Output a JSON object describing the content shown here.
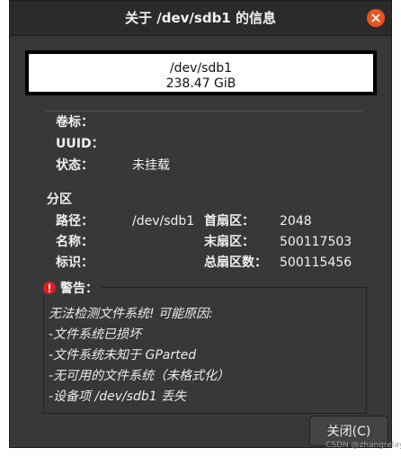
{
  "window": {
    "title": "关于 /dev/sdb1 的信息",
    "close_icon": "close-icon",
    "accent": "#e95420"
  },
  "device_box": {
    "path": "/dev/sdb1",
    "size": "238.47 GiB"
  },
  "filesystem": {
    "label_label": "卷标：",
    "uuid_label": "UUID：",
    "status_label": "状态：",
    "status_value": "未挂载"
  },
  "partition": {
    "heading": "分区",
    "path_label": "路径：",
    "path_value": "/dev/sdb1",
    "name_label": "名称：",
    "flags_label": "标识：",
    "first_sector_label": "首扇区：",
    "first_sector_value": "2048",
    "last_sector_label": "末扇区：",
    "last_sector_value": "500117503",
    "total_sectors_label": "总扇区数：",
    "total_sectors_value": "500115456"
  },
  "warning": {
    "icon": "error-icon",
    "title": "警告：",
    "color": "#e01b24",
    "lines": [
      "无法检测文件系统! 可能原因:",
      "-文件系统已损坏",
      "-文件系统未知于 GParted",
      "-无可用的文件系统（未格式化）",
      "-设备项 /dev/sdb1 丢失"
    ]
  },
  "buttons": {
    "close_label": "关闭(C)"
  },
  "watermark": "CSDN @zhangrelay"
}
